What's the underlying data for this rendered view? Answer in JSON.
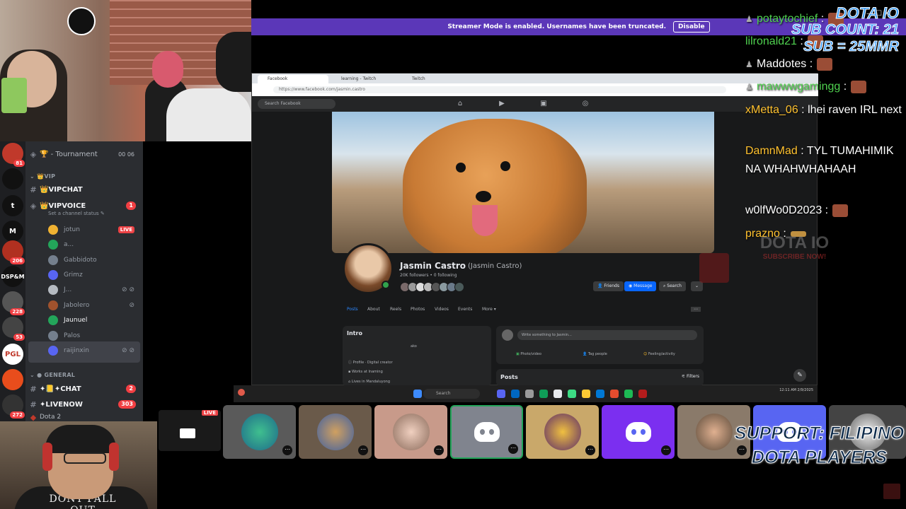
{
  "streamer_bar": {
    "message": "Streamer Mode is enabled. Usernames have been truncated.",
    "disable_label": "Disable"
  },
  "webcam_bottom": {
    "shirt_text": "DONT FALL OUT"
  },
  "discord": {
    "guild_badges": [
      "81",
      "206",
      "228",
      "53",
      "272"
    ],
    "guild_labels": [
      "t",
      "M",
      "DSP&M",
      "PGL"
    ],
    "tournament": {
      "label": "🏆 - Tournament",
      "count": "00 06"
    },
    "vip_category": "VIP",
    "vipchat": "👑VIPCHAT",
    "vipvoice": {
      "label": "👑VIPVOICE",
      "status": "Set a channel status ✎",
      "badge": "1"
    },
    "voice_users": [
      {
        "name": "jotun",
        "live": "LIVE",
        "color": "#f0b232"
      },
      {
        "name": "a...",
        "color": "#23a55a"
      },
      {
        "name": "Gabbidoto",
        "color": "#747f8d"
      },
      {
        "name": "Grimz",
        "color": "#5865f2"
      },
      {
        "name": "J...",
        "color": "#b5bac1"
      },
      {
        "name": "Jabolero",
        "color": "#a0522d"
      },
      {
        "name": "Jaunuel",
        "color": "#23a55a"
      },
      {
        "name": "Palos",
        "color": "#747f8d"
      },
      {
        "name": "raijinxin",
        "color": "#5865f2"
      }
    ],
    "general_category": "GENERAL",
    "chat_channel": {
      "label": "✦📒✦CHAT",
      "badge": "2"
    },
    "livenow_channel": {
      "label": "✦LIVENOW",
      "badge": "303"
    },
    "game_activity": "Dota 2"
  },
  "browser": {
    "tabs": [
      "Facebook",
      "learning - Twitch",
      "Twitch"
    ],
    "url": "https://www.facebook.com/jasmin.castro",
    "search_placeholder": "Search Facebook",
    "profile": {
      "name": "Jasmin Castro",
      "alt_name": "(Jasmin Castro)",
      "followers": "20K followers • 0 following",
      "buttons": {
        "friends": "Friends",
        "message": "Message",
        "search": "Search"
      },
      "tabs": [
        "Posts",
        "About",
        "Reels",
        "Photos",
        "Videos",
        "Events",
        "More ▾"
      ],
      "intro_title": "Intro",
      "intro_rows": [
        "ako",
        "Profile · Digital creator",
        "Works at Inaming",
        "Lives in Mandaluyong"
      ],
      "composer_placeholder": "Write something to Jasmin...",
      "composer_options": [
        "Photo/video",
        "Tag people",
        "Feeling/activity"
      ],
      "posts_title": "Posts",
      "filters_label": "Filters"
    }
  },
  "taskbar": {
    "search": "Search",
    "clock": "12:11 AM\n2/9/2025"
  },
  "screenshare_live": "LIVE",
  "chat": [
    {
      "user": "potaytochief",
      "text": ":",
      "color": "#4fd14f",
      "emote": true,
      "badge": true
    },
    {
      "user": "lilronald21",
      "text": ":",
      "color": "#4fd14f",
      "emote": true
    },
    {
      "user": "Maddotes",
      "text": ":",
      "color": "#ffffff",
      "emote": true,
      "badge": true
    },
    {
      "user": "mawwwgamingg",
      "text": ":",
      "color": "#4fd14f",
      "emote": true,
      "badge": true
    },
    {
      "user": "xMetta_06",
      "text": ": lhei raven IRL next",
      "color": "#ffc12e"
    },
    {
      "user": "DamnMad",
      "text": ": TYL TUMAHIMIK NA WHAHWHAHAAH",
      "color": "#ffc12e"
    },
    {
      "user": "w0lfWo0D2023",
      "text": ":",
      "color": "#ffffff",
      "emote": true
    },
    {
      "user": "prazno",
      "text": ":",
      "color": "#ffc12e",
      "emote": true
    }
  ],
  "overlay": {
    "sub_title": "DOTA IO",
    "sub_count": "SUB COUNT: 21",
    "sub_mmr": "SUB = 25MMR",
    "watermark_title": "DOTA IO",
    "watermark_sub": "SUBSCRIBE NOW!",
    "support_line1": "SUPPORT: FILIPINO",
    "support_line2": "DOTA PLAYERS",
    "window_controls": "—  ☐  ✕"
  },
  "colors": {
    "discord_bg": "#2b2d31",
    "streamer_bar": "#5b37b8",
    "fb_blue": "#0866ff",
    "discord_blurple": "#5865f2",
    "live_red": "#ed4245"
  }
}
